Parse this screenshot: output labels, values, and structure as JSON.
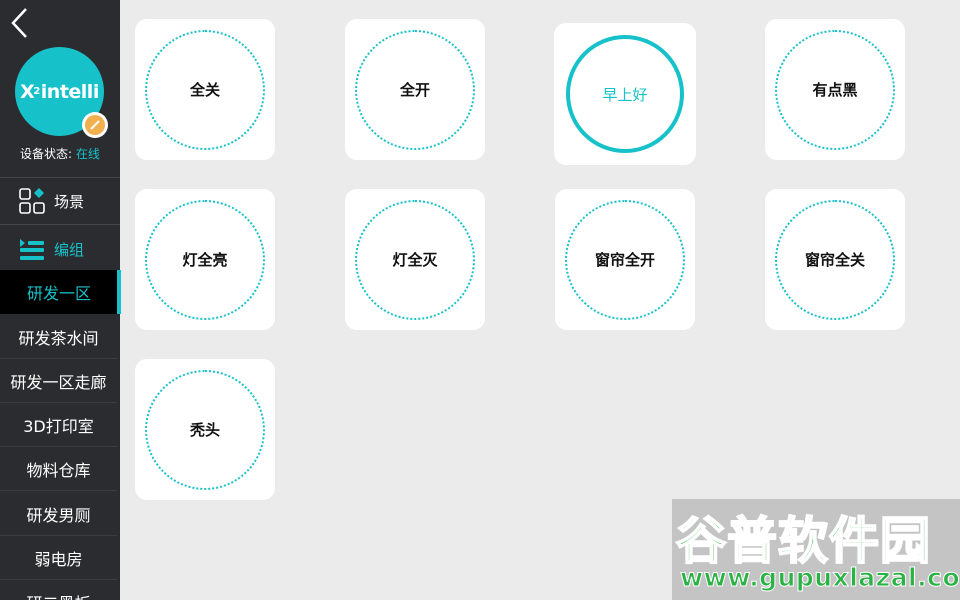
{
  "sidebar": {
    "logo_text": "intelli",
    "logo_sup": "2",
    "logo_x": "X",
    "status_label": "设备状态:",
    "status_value": "在线",
    "menu": {
      "scene_label": "场景",
      "group_label": "编组"
    },
    "zones": [
      "研发一区",
      "研发茶水间",
      "研发一区走廊",
      "3D打印室",
      "物料仓库",
      "研发男厕",
      "弱电房",
      "研二黑板"
    ],
    "selected_zone_index": 0
  },
  "cards": [
    {
      "label": "全关",
      "active": false
    },
    {
      "label": "全开",
      "active": false
    },
    {
      "label": "早上好",
      "active": true
    },
    {
      "label": "有点黑",
      "active": false
    },
    {
      "label": "灯全亮",
      "active": false
    },
    {
      "label": "灯全灭",
      "active": false
    },
    {
      "label": "窗帘全开",
      "active": false
    },
    {
      "label": "窗帘全关",
      "active": false
    },
    {
      "label": "秃头",
      "active": false
    }
  ],
  "watermark": {
    "title": "谷普软件园",
    "url": "www.gupuxlazal.com"
  },
  "colors": {
    "accent": "#17c1c9",
    "sidebar_bg": "#2b2c2f",
    "content_bg": "#ebebeb",
    "badge": "#f0b050"
  },
  "icons": {
    "back": "chevron-left-icon",
    "scene": "scene-grid-icon",
    "group": "group-list-icon",
    "edit": "edit-pencil-icon"
  }
}
